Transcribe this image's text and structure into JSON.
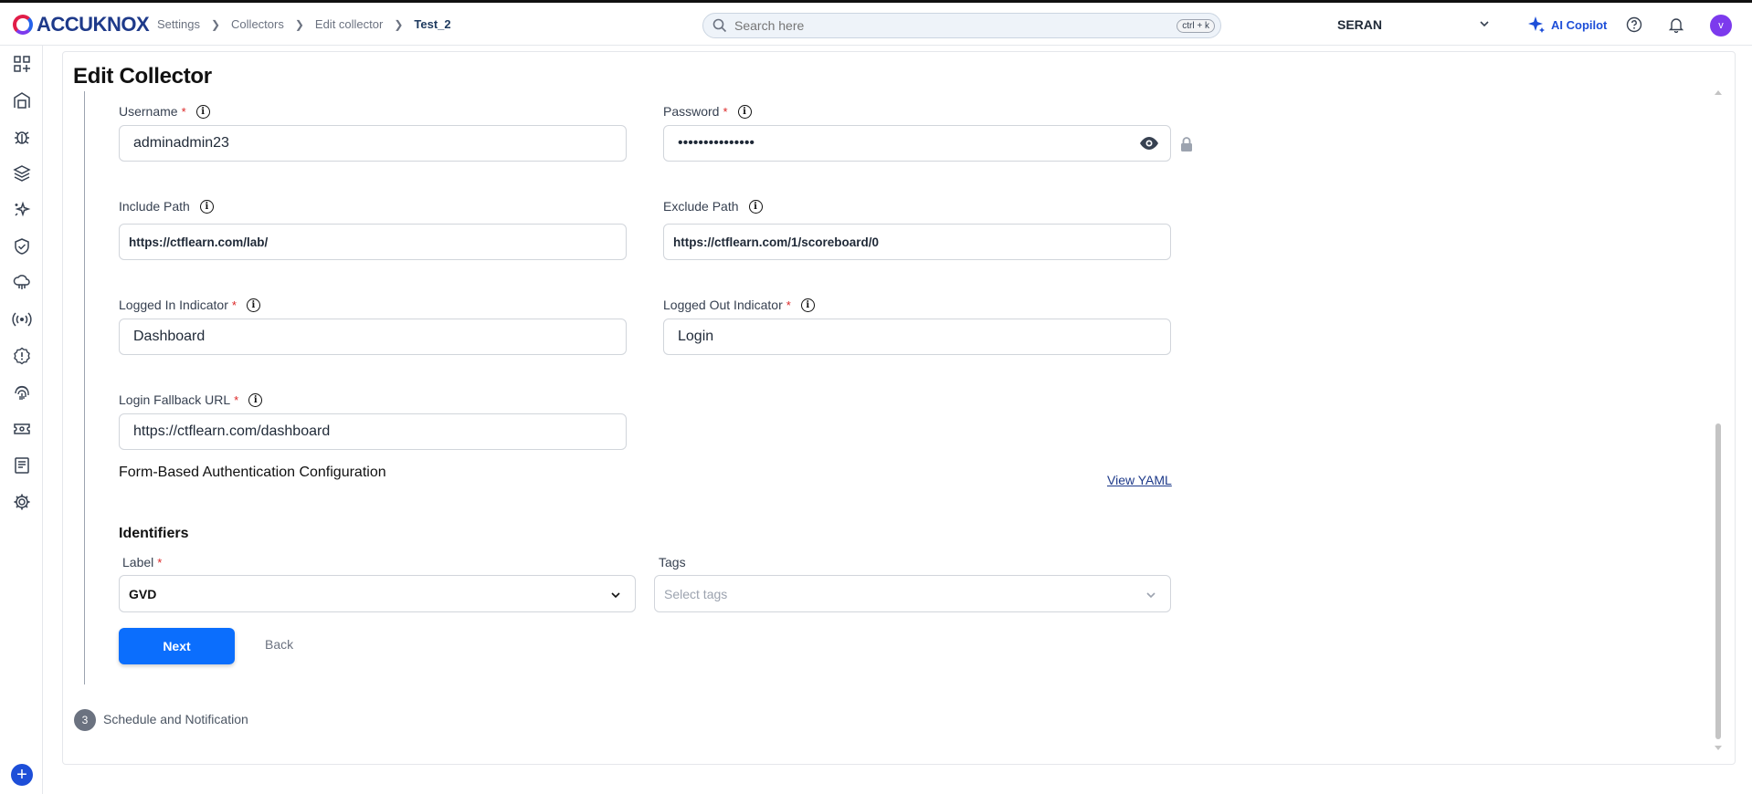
{
  "brand": {
    "name": "ACCUKNOX"
  },
  "breadcrumb": [
    "Settings",
    "Collectors",
    "Edit collector",
    "Test_2"
  ],
  "search": {
    "placeholder": "Search here",
    "shortcut": "ctrl + k"
  },
  "header": {
    "org": "SERAN",
    "copilot": "AI Copilot",
    "avatar_initial": "v"
  },
  "page": {
    "title": "Edit Collector"
  },
  "form": {
    "username": {
      "label": "Username",
      "value": "adminadmin23"
    },
    "password": {
      "label": "Password",
      "value": "•••••••••••••••"
    },
    "include_path": {
      "label": "Include Path",
      "value": "https://ctflearn.com/lab/"
    },
    "exclude_path": {
      "label": "Exclude Path",
      "value": "https://ctflearn.com/1/scoreboard/0"
    },
    "logged_in": {
      "label": "Logged In Indicator",
      "value": "Dashboard"
    },
    "logged_out": {
      "label": "Logged Out Indicator",
      "value": "Login"
    },
    "fallback_url": {
      "label": "Login Fallback URL",
      "value": "https://ctflearn.com/dashboard"
    },
    "form_auth_title": "Form-Based Authentication Configuration",
    "view_yaml": "View YAML",
    "identifiers_title": "Identifiers",
    "label_field": {
      "label": "Label",
      "value": "GVD"
    },
    "tags_field": {
      "label": "Tags",
      "placeholder": "Select tags"
    },
    "next": "Next",
    "back": "Back"
  },
  "next_step": {
    "number": "3",
    "label": "Schedule and Notification"
  },
  "colors": {
    "primary": "#0b6efd",
    "required": "#dc2626",
    "brand": "#1e3a8a"
  }
}
